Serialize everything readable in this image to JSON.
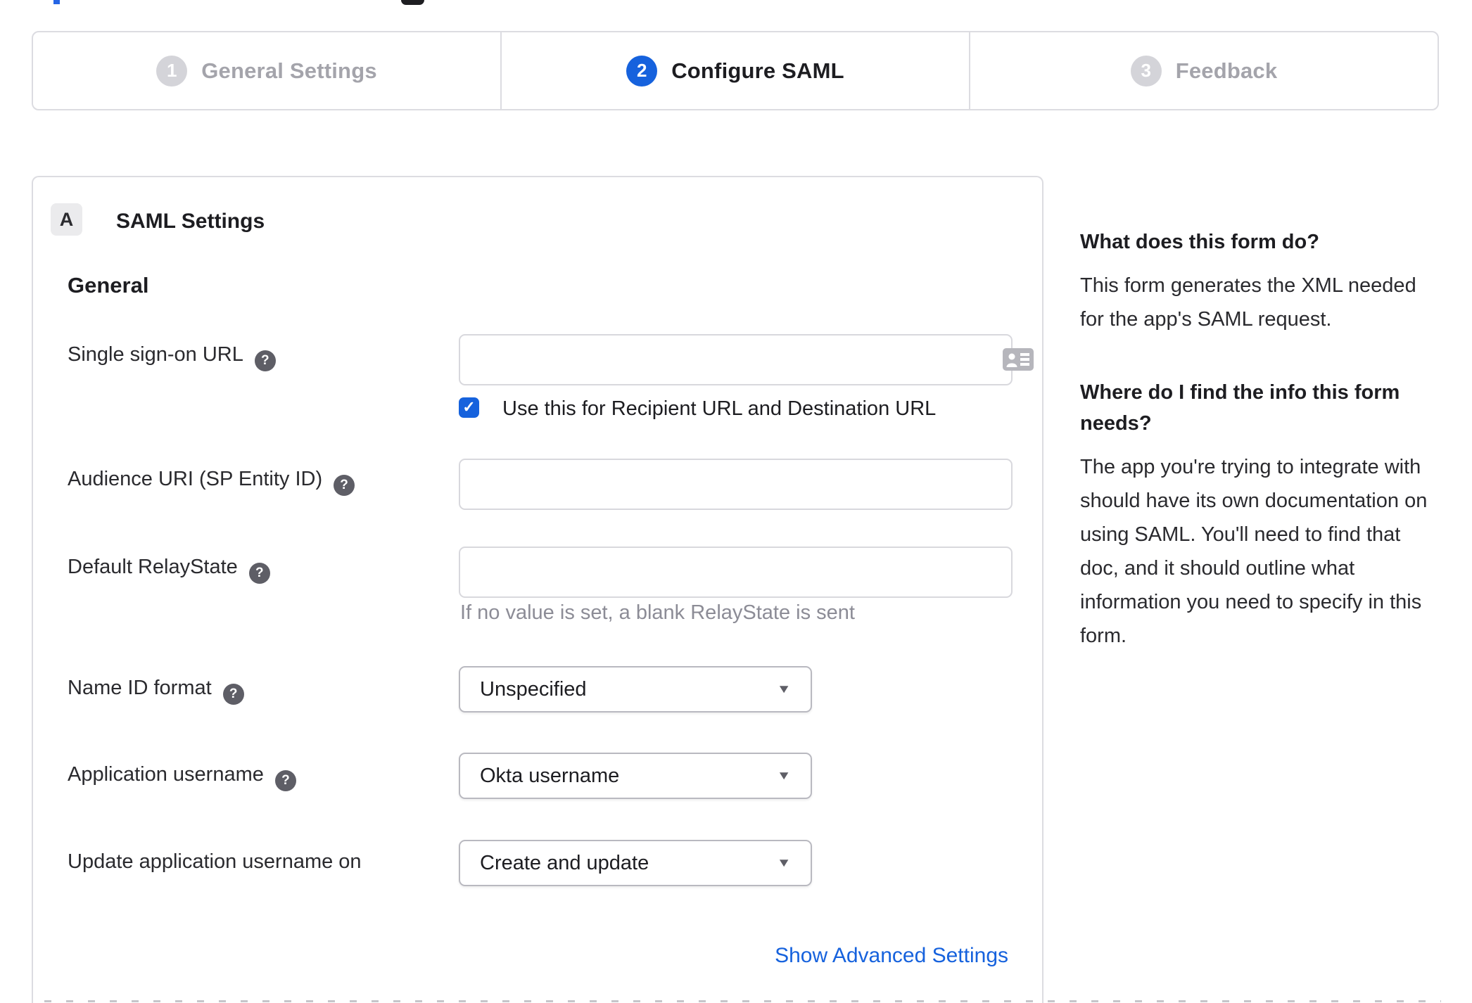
{
  "colors": {
    "accent_blue": "#1662dd",
    "border_light": "#dcdce1",
    "select_border": "#b9b9c0",
    "muted_text": "#8c8c96",
    "inactive_step": "#d4d4d9",
    "help_icon_bg": "#5e5e66"
  },
  "icons": {
    "help": "?",
    "dropdown_caret": "▼",
    "checkmark": "✓"
  },
  "stepper": {
    "steps": [
      {
        "number": "1",
        "label": "General Settings",
        "state": "inactive"
      },
      {
        "number": "2",
        "label": "Configure SAML",
        "state": "active"
      },
      {
        "number": "3",
        "label": "Feedback",
        "state": "inactive"
      }
    ]
  },
  "panel": {
    "badge": "A",
    "title": "SAML Settings",
    "section_heading": "General",
    "advanced_link": "Show Advanced Settings",
    "fields": {
      "sso": {
        "label": "Single sign-on URL",
        "value": "",
        "checkbox_label": "Use this for Recipient URL and Destination URL",
        "checkbox_checked": true
      },
      "audience": {
        "label": "Audience URI (SP Entity ID)",
        "value": ""
      },
      "relay": {
        "label": "Default RelayState",
        "value": "",
        "hint": "If no value is set, a blank RelayState is sent"
      },
      "name_id": {
        "label": "Name ID format",
        "value": "Unspecified"
      },
      "app_username": {
        "label": "Application username",
        "value": "Okta username"
      },
      "update_username": {
        "label": "Update application username on",
        "value": "Create and update"
      }
    }
  },
  "sidebar": {
    "q1": "What does this form do?",
    "a1": "This form generates the XML needed for the app's SAML request.",
    "q2": "Where do I find the info this form needs?",
    "a2": "The app you're trying to integrate with should have its own documentation on using SAML. You'll need to find that doc, and it should outline what information you need to specify in this form."
  }
}
